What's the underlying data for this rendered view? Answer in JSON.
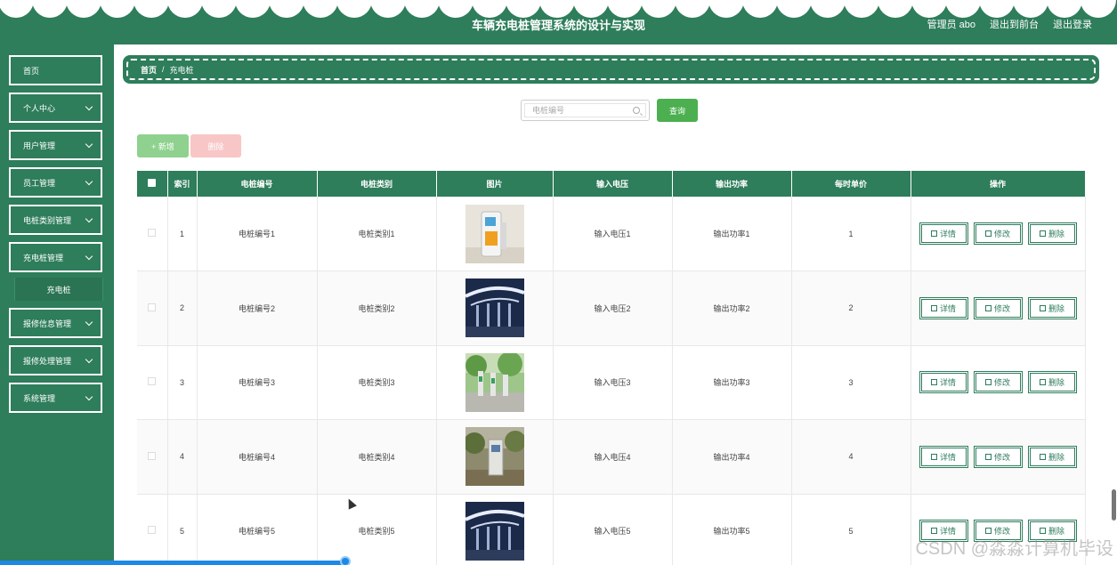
{
  "header": {
    "title": "车辆充电桩管理系统的设计与实现",
    "user": "管理员 abo",
    "back_to_front": "退出到前台",
    "logout": "退出登录"
  },
  "sidebar": {
    "items": [
      {
        "label": "首页"
      },
      {
        "label": "个人中心"
      },
      {
        "label": "用户管理"
      },
      {
        "label": "员工管理"
      },
      {
        "label": "电桩类别管理"
      },
      {
        "label": "充电桩管理"
      },
      {
        "label": "报修信息管理"
      },
      {
        "label": "报修处理管理"
      },
      {
        "label": "系统管理"
      }
    ],
    "submenu_active": "充电桩"
  },
  "breadcrumb": {
    "home": "首页",
    "separator": "/",
    "current": "充电桩"
  },
  "search": {
    "placeholder": "电桩编号",
    "value": "",
    "button": "查询"
  },
  "actions": {
    "add": "+ 新增",
    "delete": "删除"
  },
  "table": {
    "headers": [
      "",
      "索引",
      "电桩编号",
      "电桩类别",
      "图片",
      "输入电压",
      "输出功率",
      "每时单价",
      "操作"
    ],
    "rows": [
      {
        "index": "1",
        "code": "电桩编号1",
        "category": "电桩类别1",
        "image": "charger-station",
        "voltage": "输入电压1",
        "power": "输出功率1",
        "price": "1"
      },
      {
        "index": "2",
        "code": "电桩编号2",
        "category": "电桩类别2",
        "image": "charging-canopy-night",
        "voltage": "输入电压2",
        "power": "输出功率2",
        "price": "2"
      },
      {
        "index": "3",
        "code": "电桩编号3",
        "category": "电桩类别3",
        "image": "chargers-parking-green",
        "voltage": "输入电压3",
        "power": "输出功率3",
        "price": "3"
      },
      {
        "index": "4",
        "code": "电桩编号4",
        "category": "电桩类别4",
        "image": "charger-outdoor",
        "voltage": "输入电压4",
        "power": "输出功率4",
        "price": "4"
      },
      {
        "index": "5",
        "code": "电桩编号5",
        "category": "电桩类别5",
        "image": "charging-canopy-night",
        "voltage": "输入电压5",
        "power": "输出功率5",
        "price": "5"
      }
    ],
    "op_labels": {
      "detail": "详情",
      "edit": "修改",
      "delete": "删除"
    }
  },
  "watermark": "CSDN @淼淼计算机毕设",
  "colors": {
    "primary": "#2e7d5b",
    "success": "#4caf50",
    "danger_light": "#f8c6c6"
  }
}
